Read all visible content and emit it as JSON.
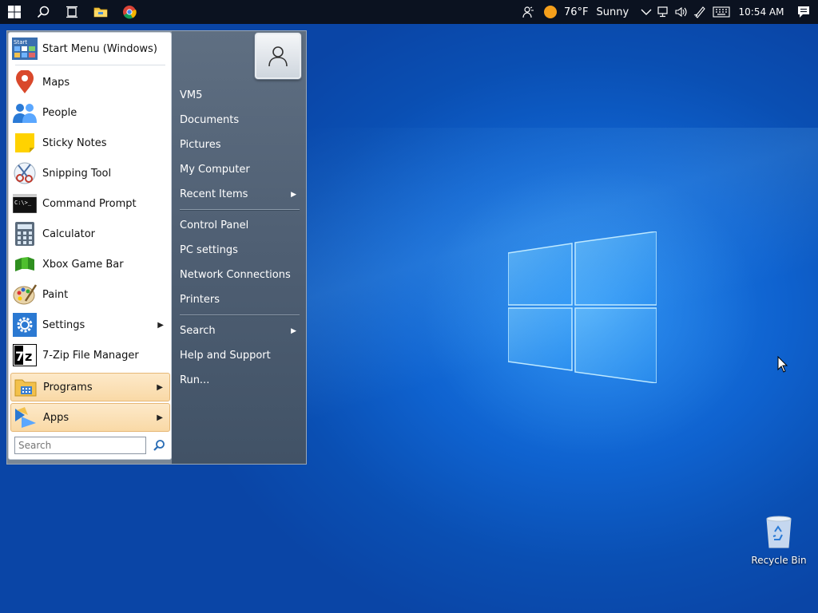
{
  "taskbar": {
    "weather": {
      "temp": "76°F",
      "condition": "Sunny"
    },
    "clock": "10:54 AM"
  },
  "start_menu": {
    "header_item": {
      "label": "Start Menu (Windows)"
    },
    "left_items": [
      {
        "label": "Maps"
      },
      {
        "label": "People"
      },
      {
        "label": "Sticky Notes"
      },
      {
        "label": "Snipping Tool"
      },
      {
        "label": "Command Prompt"
      },
      {
        "label": "Calculator"
      },
      {
        "label": "Xbox Game Bar"
      },
      {
        "label": "Paint"
      },
      {
        "label": "Settings"
      },
      {
        "label": "7-Zip File Manager"
      }
    ],
    "programs_label": "Programs",
    "apps_label": "Apps",
    "search_placeholder": "Search",
    "right_items": [
      {
        "label": "VM5"
      },
      {
        "label": "Documents"
      },
      {
        "label": "Pictures"
      },
      {
        "label": "My Computer"
      },
      {
        "label": "Recent Items"
      },
      {
        "label": "Control Panel"
      },
      {
        "label": "PC settings"
      },
      {
        "label": "Network Connections"
      },
      {
        "label": "Printers"
      },
      {
        "label": "Search"
      },
      {
        "label": "Help and Support"
      },
      {
        "label": "Run..."
      }
    ]
  },
  "desktop": {
    "recycle_bin_label": "Recycle Bin"
  },
  "colors": {
    "desktop_blue": "#0f63d0",
    "taskbar": "#0b1220",
    "menu_highlight": "#f9d9a6",
    "right_pane": "#4f5f73"
  }
}
